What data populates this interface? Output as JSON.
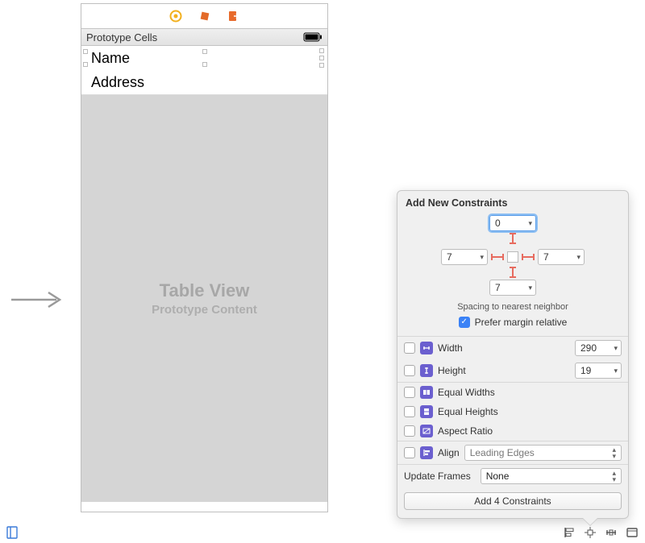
{
  "phone": {
    "header_label": "Prototype Cells",
    "rows": [
      "Name",
      "Address"
    ],
    "placeholder_title": "Table View",
    "placeholder_subtitle": "Prototype Content"
  },
  "popover": {
    "title": "Add New Constraints",
    "spacing": {
      "top": "0",
      "left": "7",
      "right": "7",
      "bottom": "7"
    },
    "spacing_hint": "Spacing to nearest neighbor",
    "prefer_margin_label": "Prefer margin relative",
    "prefer_margin_checked": true,
    "width_label": "Width",
    "width_value": "290",
    "height_label": "Height",
    "height_value": "19",
    "equal_widths_label": "Equal Widths",
    "equal_heights_label": "Equal Heights",
    "aspect_ratio_label": "Aspect Ratio",
    "align_label": "Align",
    "align_value": "Leading Edges",
    "update_frames_label": "Update Frames",
    "update_frames_value": "None",
    "add_button_label": "Add 4 Constraints"
  }
}
